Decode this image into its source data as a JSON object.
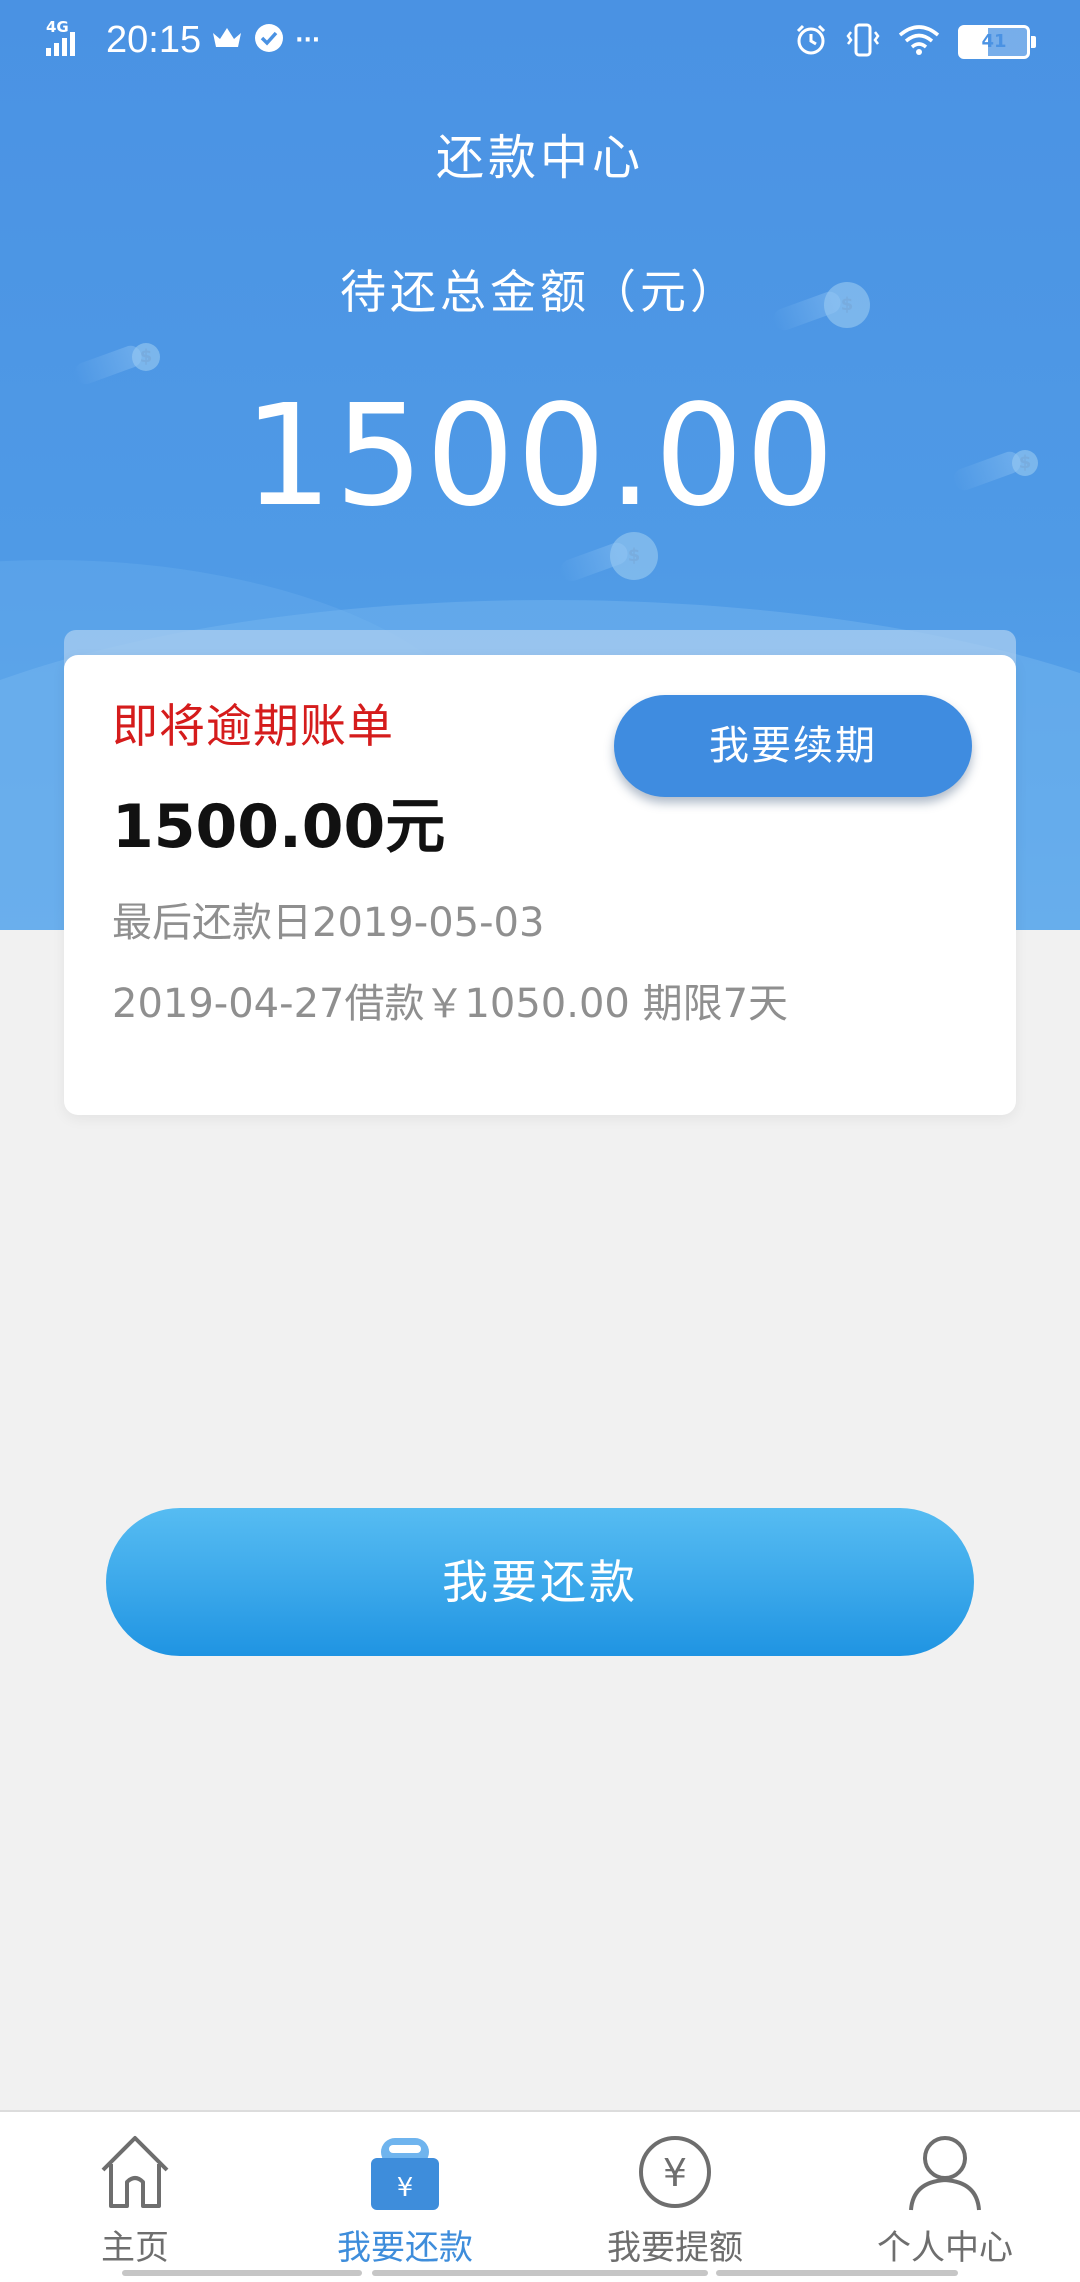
{
  "status_bar": {
    "network": "4G",
    "time": "20:15",
    "more": "···",
    "battery": "41"
  },
  "header": {
    "title": "还款中心",
    "total_label": "待还总金额（元）",
    "total_amount": "1500.00"
  },
  "bill_card": {
    "title": "即将逾期账单",
    "amount": "1500.00元",
    "due_date": "最后还款日2019-05-03",
    "loan_info": "2019-04-27借款￥1050.00 期限7天",
    "renew_label": "我要续期"
  },
  "repay_button": {
    "label": "我要还款"
  },
  "bottom_nav": {
    "items": [
      {
        "label": "主页",
        "icon": "home-icon",
        "active": false
      },
      {
        "label": "我要还款",
        "icon": "repay-wallet-icon",
        "active": true
      },
      {
        "label": "我要提额",
        "icon": "yuan-coin-icon",
        "active": false
      },
      {
        "label": "个人中心",
        "icon": "user-icon",
        "active": false
      }
    ]
  },
  "colors": {
    "primary_blue": "#4a92e3",
    "warning_red": "#d51c1c",
    "active_tab": "#3e8ddb",
    "background": "#f1f1f1"
  }
}
